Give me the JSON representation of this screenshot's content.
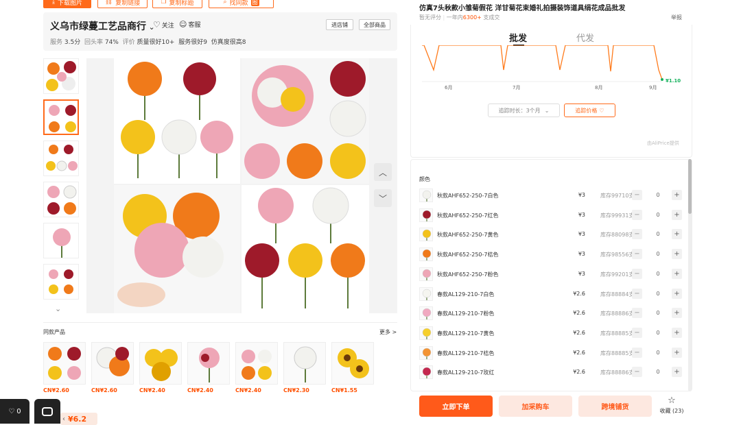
{
  "toolbar": {
    "download_label": "下载图片",
    "copy_link_label": "复制链接",
    "copy_title_label": "复制标题",
    "search_label": "找同款",
    "search_badge": "图"
  },
  "shop": {
    "name": "义乌市绿蔓工艺品商行",
    "follow_label": "关注",
    "service_label": "客服",
    "enter_shop_label": "进店铺",
    "all_products_label": "全部商品",
    "meta": {
      "service_label": "服务",
      "service_score": "3.5分",
      "repurchase_label": "回头率",
      "repurchase_value": "74%",
      "review_label": "评价",
      "quality_label": "质量很好10+",
      "service_good_label": "服务很好9",
      "realistic_label": "仿真度很高8"
    }
  },
  "similar": {
    "title": "同款产品",
    "more_label": "更多 >",
    "prices": [
      "CN¥2.60",
      "CN¥2.60",
      "CN¥2.40",
      "CN¥2.40",
      "CN¥2.40",
      "CN¥2.30",
      "CN¥1.55"
    ]
  },
  "bottom_left": {
    "like_count": "0",
    "price": "¥6.2"
  },
  "product": {
    "title": "仿真7头秋款小雏菊假花 洋甘菊花束婚礼拍摄装饰道具绢花成品批发",
    "rating_label": "暂无评分",
    "sales_prefix": "一年内",
    "sales_value": "6300+",
    "sales_suffix": "支成交",
    "report_label": "举报"
  },
  "tabs": {
    "wholesale": "批发",
    "dropship": "代发"
  },
  "price_chart": {
    "months": [
      "6月",
      "7月",
      "8月",
      "9月"
    ],
    "current_price": "¥1.10",
    "period_label": "追踪时长：3个月",
    "track_label": "追踪价格",
    "source_label": "由AliPrice提供"
  },
  "variants": {
    "section_label": "颜色",
    "items": [
      {
        "name": "秋款AHF652-250-7白色",
        "price": "¥3",
        "stock": "库存99710支",
        "qty": "0",
        "color": "#f2f2ee"
      },
      {
        "name": "秋款AHF652-250-7红色",
        "price": "¥3",
        "stock": "库存99931支",
        "qty": "0",
        "color": "#9e1a2a"
      },
      {
        "name": "秋款AHF652-250-7黄色",
        "price": "¥3",
        "stock": "库存88098支",
        "qty": "0",
        "color": "#f3c21b"
      },
      {
        "name": "秋款AHF652-250-7桔色",
        "price": "¥3",
        "stock": "库存98556支",
        "qty": "0",
        "color": "#f07a1a"
      },
      {
        "name": "秋款AHF652-250-7粉色",
        "price": "¥3",
        "stock": "库存99201支",
        "qty": "0",
        "color": "#eea6b6"
      },
      {
        "name": "春款AL129-210-7白色",
        "price": "¥2.6",
        "stock": "库存88884支",
        "qty": "0",
        "color": "#f5f5f0"
      },
      {
        "name": "春款AL129-210-7粉色",
        "price": "¥2.6",
        "stock": "库存88886支",
        "qty": "0",
        "color": "#f0a9c0"
      },
      {
        "name": "春款AL129-210-7黄色",
        "price": "¥2.6",
        "stock": "库存88885支",
        "qty": "0",
        "color": "#f6cf2c"
      },
      {
        "name": "春款AL129-210-7桔色",
        "price": "¥2.6",
        "stock": "库存88885支",
        "qty": "0",
        "color": "#f39434"
      },
      {
        "name": "春款AL129-210-7玫红",
        "price": "¥2.6",
        "stock": "库存88886支",
        "qty": "0",
        "color": "#c4284f"
      }
    ]
  },
  "actions": {
    "order_label": "立即下单",
    "cart_label": "加采购车",
    "crossshop_label": "跨境铺货",
    "favorite_label": "收藏 (23)"
  },
  "colors": {
    "accent": "#ff6a1a",
    "price_red": "#ff5000",
    "chart_line": "#ff7a1a",
    "chart_end": "#13b15b"
  }
}
